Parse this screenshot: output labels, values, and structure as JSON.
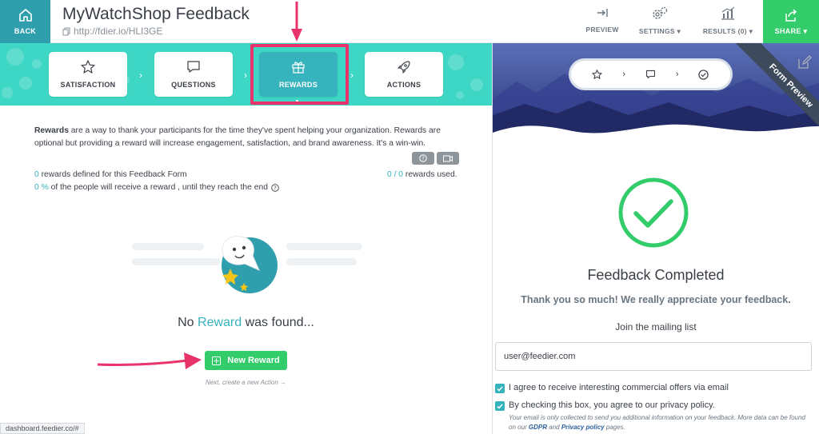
{
  "header": {
    "back_label": "BACK",
    "title": "MyWatchShop Feedback",
    "url": "http://fdier.io/HLI3GE",
    "preview_label": "PREVIEW",
    "settings_label": "SETTINGS",
    "results_label": "RESULTS (0)",
    "share_label": "SHARE"
  },
  "steps": [
    {
      "label": "SATISFACTION",
      "icon": "star-icon"
    },
    {
      "label": "QUESTIONS",
      "icon": "speech-bubble-icon"
    },
    {
      "label": "REWARDS",
      "icon": "gift-icon"
    },
    {
      "label": "ACTIONS",
      "icon": "rocket-icon"
    }
  ],
  "rewards": {
    "desc_bold": "Rewards",
    "desc_rest": " are a way to thank your participants for the time they've spent helping your organization. Rewards are optional but providing a reward will increase engagement, satisfaction, and brand awareness. It's a win-win.",
    "defined_count": "0",
    "defined_text": " rewards defined for this Feedback Form",
    "percent": "0 %",
    "percent_text": " of the people will receive a reward , until they reach the end",
    "used_count": "0 / 0",
    "used_text": " rewards used.",
    "empty_prefix": "No ",
    "empty_word": "Reward",
    "empty_suffix": " was found...",
    "new_button": "New Reward",
    "next_link": "Next, create a new Action →"
  },
  "status_bar": "dashboard.feedier.co/#",
  "preview": {
    "ribbon": "Form Preview",
    "title": "Feedback Completed",
    "thanks": "Thank you so much! We really appreciate your feedback.",
    "join": "Join the mailing list",
    "email_value": "user@feedier.com",
    "consent1": "I agree to receive interesting commercial offers via email",
    "consent2": "By checking this box, you agree to our privacy policy.",
    "fine_print_a": "Your email is only collected to send you additional information on your feedback. More data can be found on our ",
    "gdpr": "GDPR",
    "fine_print_b": " and ",
    "privacy": "Privacy policy",
    "fine_print_c": " pages."
  },
  "colors": {
    "teal": "#37b3bd",
    "mint": "#3ed6c4",
    "green": "#33cc6a",
    "highlight": "#e8336b",
    "navy": "#2b3a78"
  }
}
